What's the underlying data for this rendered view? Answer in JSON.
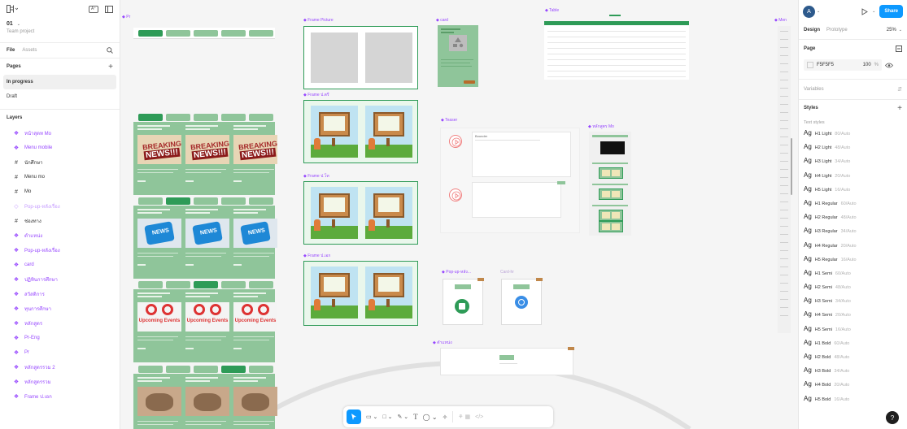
{
  "left_panel": {
    "project_name": "01",
    "team": "Team project",
    "tab_file": "File",
    "tab_assets": "Assets",
    "pages_heading": "Pages",
    "pages": [
      "In progress",
      "Draft"
    ],
    "layers_heading": "Layers",
    "layers": [
      {
        "label": "หน้าสุดท Mo",
        "kind": "component"
      },
      {
        "label": "Menu mobile",
        "kind": "component"
      },
      {
        "label": "นักศึกษา",
        "kind": "frame"
      },
      {
        "label": "Menu mo",
        "kind": "frame"
      },
      {
        "label": "Mo",
        "kind": "frame"
      },
      {
        "label": "Pop-up-หลังเรื่อง",
        "kind": "dim"
      },
      {
        "label": "ช่องทาง",
        "kind": "frame"
      },
      {
        "label": "ตำแหน่ง",
        "kind": "component"
      },
      {
        "label": "Pop-up-หลังเรื่อง",
        "kind": "component"
      },
      {
        "label": "card",
        "kind": "component"
      },
      {
        "label": "ปฏิทินการศึกษา",
        "kind": "component"
      },
      {
        "label": "สวัสดิการ",
        "kind": "component"
      },
      {
        "label": "ทุนการศึกษา",
        "kind": "component"
      },
      {
        "label": "หลักสูตร",
        "kind": "component"
      },
      {
        "label": "Pr-Eng",
        "kind": "component"
      },
      {
        "label": "Pr",
        "kind": "component"
      },
      {
        "label": "หลักสูตรรวม 2",
        "kind": "component"
      },
      {
        "label": "หลักสูตรรวม",
        "kind": "component"
      },
      {
        "label": "Frame ป.เอก",
        "kind": "component"
      }
    ]
  },
  "canvas": {
    "labels": {
      "pr": "Pr",
      "frame_picture": "Frame Picture",
      "frame_pt": "Frame ป.ตรี",
      "frame_po": "Frame ป.โท",
      "frame_pe": "Frame ป.เอก",
      "card": "card",
      "table": "Table",
      "teaser": "Teaser",
      "teaser_inner": "Bounder",
      "lakasut_mo": "หลักสูตร Mo",
      "popup": "Pop-up-หลัง...",
      "popup2": "Card-hr",
      "tamnaeng": "ตำแหน่ง",
      "men": "Men"
    },
    "news_text": "NEWS!!!",
    "breaking_text": "BREAKING",
    "upcoming_text": "Upcoming Events",
    "puzzle_text": "NEWS"
  },
  "toolbar": {
    "tools": [
      "move-tool",
      "frame-tool",
      "shape-tool",
      "pen-tool",
      "text-tool",
      "comment-tool",
      "actions-tool",
      "dev-mode",
      "apps-tool"
    ]
  },
  "right_panel": {
    "avatar_letter": "A",
    "share_label": "Share",
    "tab_design": "Design",
    "tab_prototype": "Prototype",
    "zoom": "25%",
    "page_heading": "Page",
    "page_color": "F5F5F5",
    "page_opacity": "100",
    "page_opacity_unit": "%",
    "variables_label": "Variables",
    "styles_heading": "Styles",
    "text_styles_heading": "Text styles",
    "text_styles": [
      {
        "name": "H1 Light",
        "value": "80/Auto"
      },
      {
        "name": "H2 Light",
        "value": "48/Auto"
      },
      {
        "name": "H3 Light",
        "value": "34/Auto"
      },
      {
        "name": "H4 Light",
        "value": "20/Auto"
      },
      {
        "name": "H5 Light",
        "value": "16/Auto"
      },
      {
        "name": "H1 Regular",
        "value": "60/Auto"
      },
      {
        "name": "H2 Regular",
        "value": "48/Auto"
      },
      {
        "name": "H3 Regular",
        "value": "34/Auto"
      },
      {
        "name": "H4 Regular",
        "value": "20/Auto"
      },
      {
        "name": "H5 Regular",
        "value": "16/Auto"
      },
      {
        "name": "H1 Semi",
        "value": "60/Auto"
      },
      {
        "name": "H2 Semi",
        "value": "48/Auto"
      },
      {
        "name": "H3 Semi",
        "value": "34/Auto"
      },
      {
        "name": "H4 Semi",
        "value": "20/Auto"
      },
      {
        "name": "H5 Semi",
        "value": "16/Auto"
      },
      {
        "name": "H1 Bold",
        "value": "60/Auto"
      },
      {
        "name": "H2 Bold",
        "value": "48/Auto"
      },
      {
        "name": "H3 Bold",
        "value": "34/Auto"
      },
      {
        "name": "H4 Bold",
        "value": "20/Auto"
      },
      {
        "name": "H5 Bold",
        "value": "16/Auto"
      }
    ],
    "text_style_glyph": "Ag",
    "help_label": "?"
  },
  "colors": {
    "accent": "#0d99ff",
    "component": "#9747ff",
    "green": "#2e9b57",
    "light_green": "#8fc59a",
    "canvas": "#f5f5f5"
  }
}
